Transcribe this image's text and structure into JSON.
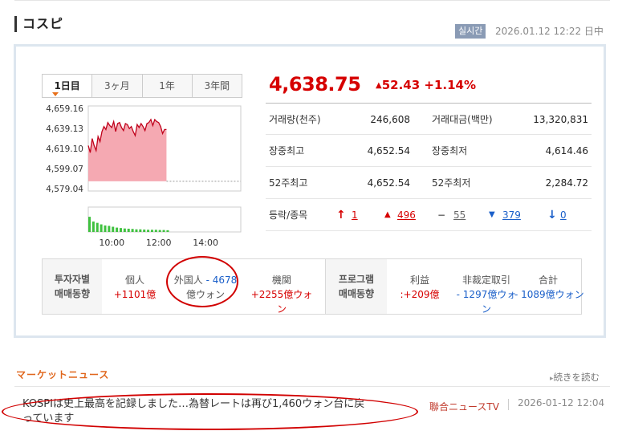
{
  "header": {
    "title": "コスピ",
    "realtime_badge": "실시간",
    "timestamp": "2026.01.12 12:22 日中"
  },
  "tabs": [
    {
      "label": "1日目",
      "active": true
    },
    {
      "label": "3ヶ月",
      "active": false
    },
    {
      "label": "1年",
      "active": false
    },
    {
      "label": "3年間",
      "active": false
    }
  ],
  "chart_data": {
    "type": "area",
    "y_ticks": [
      "4,659.16",
      "4,639.13",
      "4,619.10",
      "4,599.07",
      "4,579.04"
    ],
    "x_ticks": [
      "10:00",
      "12:00",
      "14:00"
    ],
    "ylim": [
      4579.04,
      4659.16
    ],
    "previous_close": 4586.32,
    "x": [
      "09:00",
      "09:05",
      "09:10",
      "09:15",
      "09:20",
      "09:25",
      "09:30",
      "09:35",
      "09:40",
      "09:45",
      "09:50",
      "09:55",
      "10:00",
      "10:05",
      "10:10",
      "10:15",
      "10:20",
      "10:25",
      "10:30",
      "10:35",
      "10:40",
      "10:45",
      "10:50",
      "10:55",
      "11:00",
      "11:05",
      "11:10",
      "11:15",
      "11:20",
      "11:25",
      "11:30",
      "11:35",
      "11:40",
      "11:45",
      "11:50",
      "11:55",
      "12:00",
      "12:05",
      "12:10",
      "12:15",
      "12:20"
    ],
    "values": [
      4622,
      4615,
      4629,
      4622,
      4617,
      4631,
      4626,
      4636,
      4641,
      4638,
      4645,
      4642,
      4640,
      4646,
      4636,
      4644,
      4645,
      4640,
      4637,
      4644,
      4643,
      4639,
      4641,
      4636,
      4632,
      4643,
      4640,
      4644,
      4641,
      4637,
      4644,
      4645,
      4648,
      4642,
      4648,
      4646,
      4645,
      4641,
      4634,
      4638,
      4638
    ],
    "volume_relative": [
      0.7,
      0.48,
      0.42,
      0.35,
      0.3,
      0.28,
      0.24,
      0.2,
      0.18,
      0.16,
      0.15,
      0.14,
      0.12,
      0.12,
      0.11,
      0.1,
      0.1,
      0.1,
      0.09,
      0.09,
      0.08
    ]
  },
  "quote": {
    "price": "4,638.75",
    "change": "52.43",
    "change_pct": "+1.14%",
    "direction": "up"
  },
  "stats": {
    "volume_label": "거래량(천주)",
    "volume": "246,608",
    "value_label": "거래대금(백만)",
    "value": "13,320,831",
    "day_high_label": "장중최고",
    "day_high": "4,652.54",
    "day_low_label": "장중최저",
    "day_low": "4,614.46",
    "wk52_high_label": "52주최고",
    "wk52_high": "4,652.54",
    "wk52_low_label": "52주최저",
    "wk52_low": "2,284.72",
    "breadth_label": "등락/종목",
    "upper_limit": "1",
    "rising": "496",
    "unchanged": "55",
    "falling": "379",
    "lower_limit": "0"
  },
  "investors": {
    "head_line1": "투자자별",
    "head_line2": "매매동향",
    "individual_label": "個人",
    "individual_value": "+1101億",
    "foreign_label": "外国人",
    "foreign_value": "- 4678",
    "foreign_unit": "億ウォン",
    "institution_label": "機関",
    "institution_value": "+2255億ウォ",
    "institution_value_wrap": "ン",
    "program_line1": "프로그램",
    "program_line2": "매매동향",
    "arbitrage_label": "利益",
    "arbitrage_value": ":+209億",
    "nonarb_label": "非裁定取引",
    "nonarb_value": "- 1297億ウォ",
    "nonarb_value_wrap": "ン",
    "total_label": "合計",
    "total_value": "- 1089億ウォン"
  },
  "news": {
    "section_title": "マーケットニュース",
    "more_label": "続きを読む",
    "headline_line1": "KOSPIは史上最高を記録しました…為替レートは再び1,460ウォン台に戻",
    "headline_line2": "っています",
    "source": "聯合ニュースTV",
    "date": "2026-01-12 12:04"
  },
  "colors": {
    "up": "#d60000",
    "down": "#1a5fc9",
    "accent": "#e0661c",
    "annotation": "#d10000",
    "chart_fill": "#f4a0aa",
    "chart_line": "#c0001a",
    "volume_bar": "#3fc13f"
  }
}
